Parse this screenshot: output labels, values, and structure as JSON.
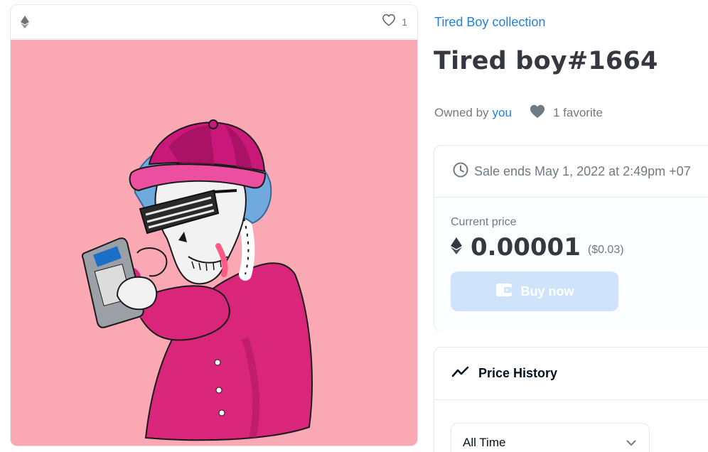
{
  "art_card": {
    "like_count": "1",
    "image_alt": "Tired boy#1664 artwork",
    "background_color": "#f9a8b4"
  },
  "item": {
    "collection": "Tired Boy collection",
    "title": "Tired boy#1664",
    "owned_by_label": "Owned by",
    "owner": "you",
    "favorites": "1 favorite"
  },
  "sale": {
    "ends_text": "Sale ends May 1, 2022 at 2:49pm +07",
    "current_price_label": "Current price",
    "price": "0.00001",
    "price_usd": "($0.03)",
    "buy_label": "Buy now",
    "buy_color": "#cfe4fa"
  },
  "price_history": {
    "title": "Price History",
    "range_selected": "All Time"
  },
  "colors": {
    "link": "#2081e2",
    "text": "#353840",
    "muted": "#707a83"
  }
}
